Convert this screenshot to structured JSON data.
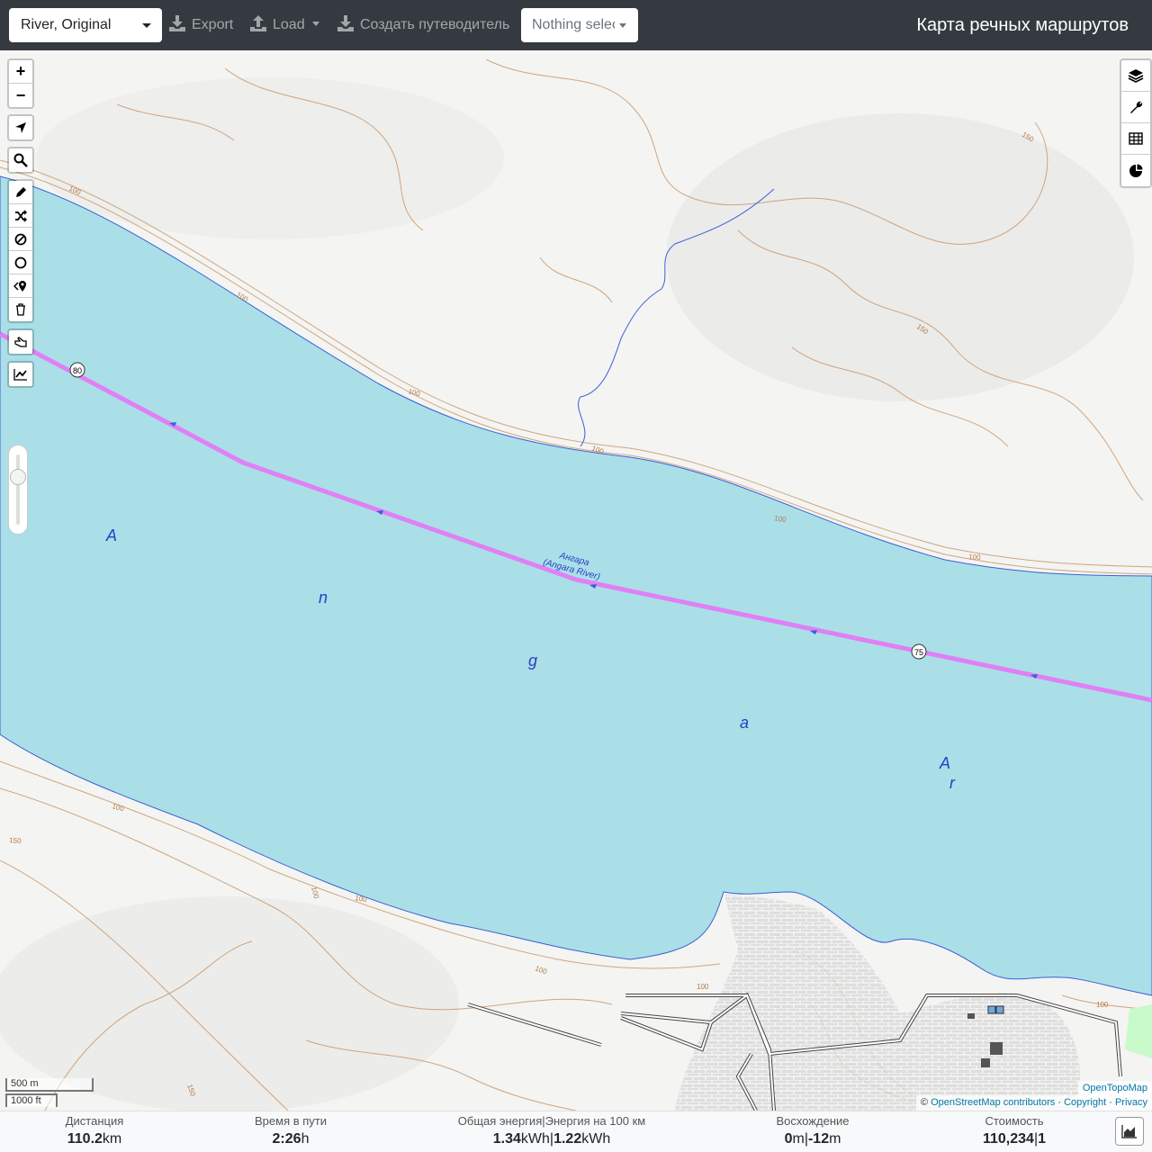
{
  "header": {
    "profile_select": "River, Original",
    "export_label": "Export",
    "load_label": "Load",
    "guide_label": "Создать путеводитель",
    "layer_select_placeholder": "Nothing selected",
    "app_title": "Карта речных маршрутов"
  },
  "map": {
    "river_name_local": "Ангара",
    "river_name_en": "(Angara River)",
    "river_letters": [
      "A",
      "n",
      "g",
      "a",
      "A",
      "r"
    ],
    "waypoint_markers": [
      "80",
      "75"
    ],
    "contour_labels": [
      "100",
      "100",
      "100",
      "100",
      "100",
      "100",
      "150",
      "150",
      "100",
      "150",
      "100",
      "100",
      "100",
      "100",
      "100",
      "150"
    ],
    "colors": {
      "water": "#aadfe7",
      "route": "#e080f5",
      "contour": "#c79363",
      "land": "#f4f4f2"
    }
  },
  "controls": {
    "zoom_in": "+",
    "zoom_out": "−",
    "left_tools": [
      "locate-icon",
      "search-icon",
      "pencil-icon",
      "shuffle-icon",
      "block-icon",
      "circle-icon",
      "poi-icon",
      "trash-icon",
      "hand-icon",
      "elevation-chart-icon"
    ],
    "right_tools": [
      "layers-icon",
      "wrench-icon",
      "table-icon",
      "pie-chart-icon"
    ]
  },
  "scale": {
    "metric": "500 m",
    "imperial": "1000 ft"
  },
  "attribution": {
    "opentopomap": "OpenTopoMap",
    "copyright_symbol": "©",
    "osm": "OpenStreetMap contributors",
    "sep1": "·",
    "copyright": "Copyright",
    "sep2": "·",
    "privacy": "Privacy"
  },
  "stats": {
    "distance_label": "Дистанция",
    "distance_value": "110.2",
    "distance_unit": "km",
    "time_label": "Время в пути",
    "time_value": "2:26",
    "time_unit": "h",
    "energy_label": "Общая энергия|Энергия на 100 км",
    "energy_total": "1.34",
    "energy_total_unit": "kWh",
    "energy_sep": "|",
    "energy_per100": "1.22",
    "energy_per100_unit": "kWh",
    "ascent_label": "Восхождение",
    "ascent_up": "0",
    "ascent_up_unit": "m",
    "ascent_sep": "|",
    "ascent_down": "-12",
    "ascent_down_unit": "m",
    "cost_label": "Стоимость",
    "cost_value": "110,234",
    "cost_sep": "|",
    "cost_value2": "1"
  }
}
